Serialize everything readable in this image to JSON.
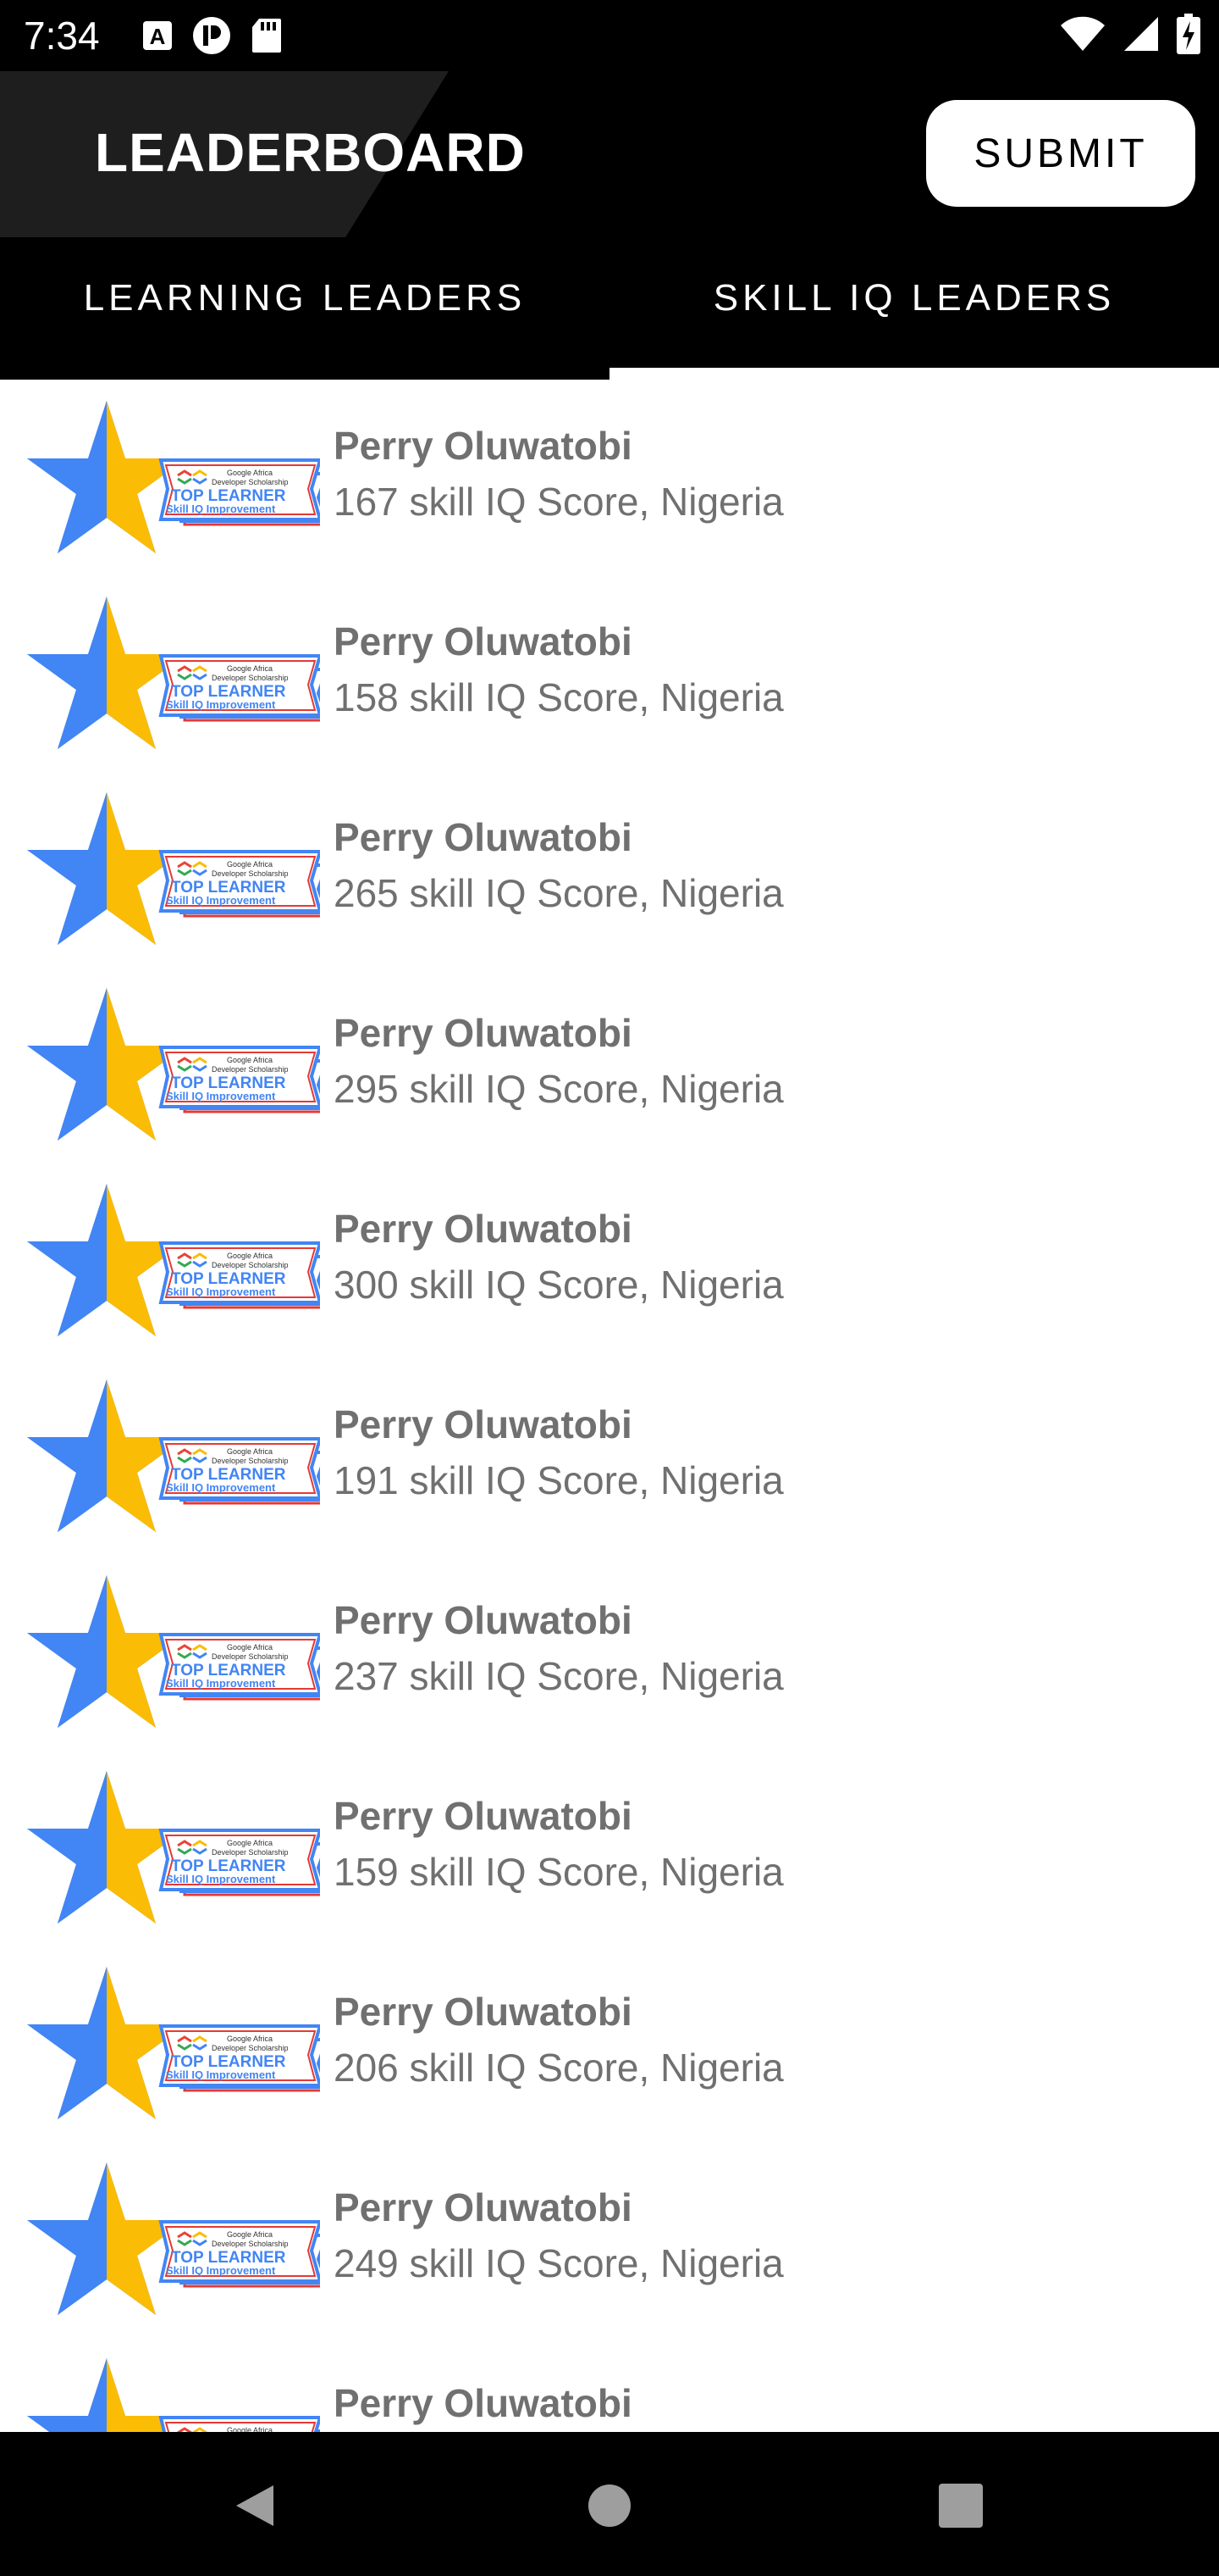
{
  "status_bar": {
    "time": "7:34",
    "left_icons": [
      "a-notification-icon",
      "p-notification-icon",
      "sd-card-icon"
    ],
    "right_icons": [
      "wifi-icon",
      "signal-icon",
      "battery-charging-icon"
    ]
  },
  "header": {
    "title": "LEADERBOARD",
    "submit_label": "SUBMIT"
  },
  "tabs": [
    {
      "label": "LEARNING LEADERS",
      "selected": true
    },
    {
      "label": "SKILL IQ LEADERS",
      "selected": false
    }
  ],
  "badge": {
    "icon": "top-learner-star-badge",
    "line1": "Google Africa",
    "line2": "Developer Scholarship",
    "title": "TOP LEARNER",
    "subtitle": "Skill IQ Improvement"
  },
  "leaders": [
    {
      "name": "Perry Oluwatobi",
      "detail": "167 skill IQ Score, Nigeria"
    },
    {
      "name": "Perry Oluwatobi",
      "detail": "158 skill IQ Score, Nigeria"
    },
    {
      "name": "Perry Oluwatobi",
      "detail": "265 skill IQ Score, Nigeria"
    },
    {
      "name": "Perry Oluwatobi",
      "detail": "295 skill IQ Score, Nigeria"
    },
    {
      "name": "Perry Oluwatobi",
      "detail": "300 skill IQ Score, Nigeria"
    },
    {
      "name": "Perry Oluwatobi",
      "detail": "191 skill IQ Score, Nigeria"
    },
    {
      "name": "Perry Oluwatobi",
      "detail": "237 skill IQ Score, Nigeria"
    },
    {
      "name": "Perry Oluwatobi",
      "detail": "159 skill IQ Score, Nigeria"
    },
    {
      "name": "Perry Oluwatobi",
      "detail": "206 skill IQ Score, Nigeria"
    },
    {
      "name": "Perry Oluwatobi",
      "detail": "249 skill IQ Score, Nigeria"
    },
    {
      "name": "Perry Oluwatobi",
      "detail": ""
    }
  ],
  "nav_bar": {
    "buttons": [
      "back-icon",
      "home-icon",
      "recents-icon"
    ]
  },
  "colors": {
    "background": "#000000",
    "star_blue": "#4285F4",
    "star_yellow": "#FBBC05",
    "badge_red": "#E53935",
    "text_gray": "#707070"
  }
}
